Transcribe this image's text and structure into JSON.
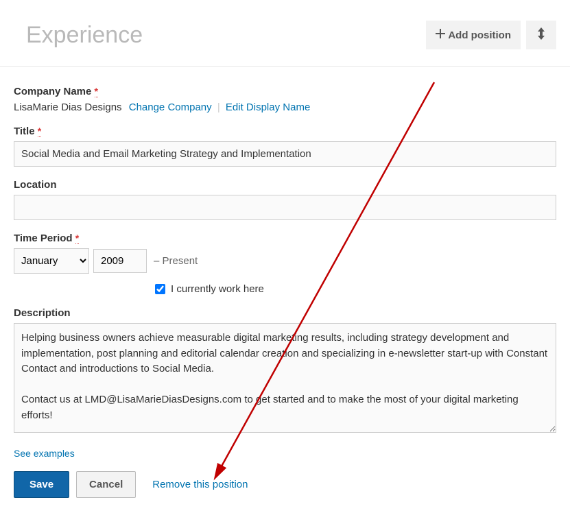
{
  "header": {
    "title": "Experience",
    "add_position_label": "Add position"
  },
  "company": {
    "label": "Company Name",
    "value": "LisaMarie Dias Designs",
    "change_link": "Change Company",
    "edit_display_link": "Edit Display Name"
  },
  "title_field": {
    "label": "Title",
    "value": "Social Media and Email Marketing Strategy and Implementation"
  },
  "location": {
    "label": "Location",
    "value": ""
  },
  "time_period": {
    "label": "Time Period",
    "month": "January",
    "year": "2009",
    "present_suffix": "– Present",
    "checkbox_label": "I currently work here"
  },
  "description": {
    "label": "Description",
    "value": "Helping business owners achieve measurable digital marketing results, including strategy development and implementation, post planning and editorial calendar creation and specializing in e-newsletter start-up with Constant Contact and introductions to Social Media.\n\nContact us at LMD@LisaMarieDiasDesigns.com to get started and to make the most of your digital marketing efforts!"
  },
  "footer": {
    "see_examples": "See examples",
    "save": "Save",
    "cancel": "Cancel",
    "remove": "Remove this position"
  },
  "required_marker": "*"
}
